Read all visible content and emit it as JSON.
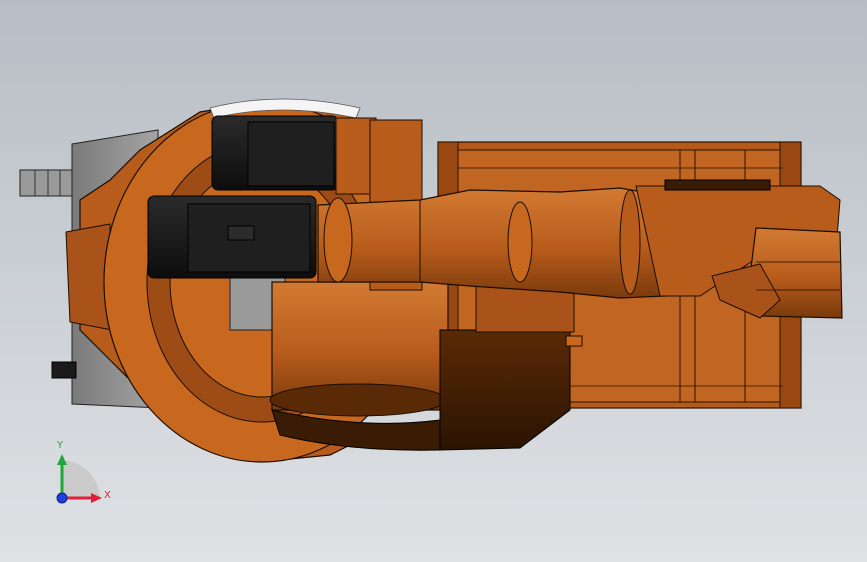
{
  "viewport": {
    "background_top": "#b7bdc4",
    "background_bottom": "#dfe2e5"
  },
  "model": {
    "colors": {
      "body_orange": "#c8681f",
      "body_dark": "#6e3408",
      "body_mid": "#a9531a",
      "motor_black": "#151515",
      "housing_gray": "#8f8f8f",
      "outline": "#1a0d00"
    },
    "parts": [
      "base-gray-housing",
      "rotary-base",
      "motor-upper",
      "motor-lower",
      "lower-arm",
      "upper-arm",
      "wrist",
      "tool-tray"
    ]
  },
  "triad": {
    "x_label": "X",
    "y_label": "Y",
    "x_color": "#e0203a",
    "y_color": "#1fa83a",
    "z_color": "#1b3fe0"
  }
}
